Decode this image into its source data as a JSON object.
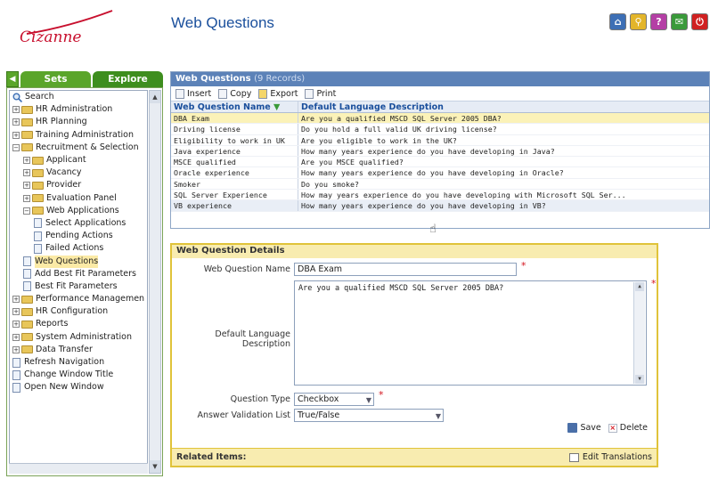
{
  "brand": {
    "logo_text": "Cizanne"
  },
  "page": {
    "title": "Web Questions"
  },
  "top_icons": [
    {
      "name": "home-icon",
      "color": "#3d6fb5",
      "glyph": "⌂"
    },
    {
      "name": "search-icon",
      "color": "#e3b52a",
      "glyph": "⚲"
    },
    {
      "name": "help-icon",
      "color": "#b43fa5",
      "glyph": "?"
    },
    {
      "name": "mail-icon",
      "color": "#3a9a3a",
      "glyph": "✉"
    },
    {
      "name": "power-icon",
      "color": "#d02020",
      "glyph": "⏻"
    }
  ],
  "sidebar": {
    "tabs": {
      "sets": "Sets",
      "explore": "Explore"
    },
    "items": [
      {
        "label": "Search",
        "type": "search",
        "indent": 0
      },
      {
        "label": "HR Administration",
        "type": "folder",
        "indent": 0,
        "exp": "+"
      },
      {
        "label": "HR Planning",
        "type": "folder",
        "indent": 0,
        "exp": "+"
      },
      {
        "label": "Training Administration",
        "type": "folder",
        "indent": 0,
        "exp": "+"
      },
      {
        "label": "Recruitment & Selection",
        "type": "folder",
        "indent": 0,
        "exp": "−"
      },
      {
        "label": "Applicant",
        "type": "folder",
        "indent": 1,
        "exp": "+"
      },
      {
        "label": "Vacancy",
        "type": "folder",
        "indent": 1,
        "exp": "+"
      },
      {
        "label": "Provider",
        "type": "folder",
        "indent": 1,
        "exp": "+"
      },
      {
        "label": "Evaluation Panel",
        "type": "folder",
        "indent": 1,
        "exp": "+"
      },
      {
        "label": "Web Applications",
        "type": "folder",
        "indent": 1,
        "exp": "−"
      },
      {
        "label": "Select Applications",
        "type": "page",
        "indent": 2
      },
      {
        "label": "Pending Actions",
        "type": "page",
        "indent": 2
      },
      {
        "label": "Failed Actions",
        "type": "page",
        "indent": 2
      },
      {
        "label": "Web Questions",
        "type": "page",
        "indent": 1,
        "selected": true
      },
      {
        "label": "Add Best Fit Parameters",
        "type": "page",
        "indent": 1
      },
      {
        "label": "Best Fit Parameters",
        "type": "page",
        "indent": 1
      },
      {
        "label": "Performance Managemen",
        "type": "folder",
        "indent": 0,
        "exp": "+"
      },
      {
        "label": "HR Configuration",
        "type": "folder",
        "indent": 0,
        "exp": "+"
      },
      {
        "label": "Reports",
        "type": "folder",
        "indent": 0,
        "exp": "+"
      },
      {
        "label": "System Administration",
        "type": "folder",
        "indent": 0,
        "exp": "+"
      },
      {
        "label": "Data Transfer",
        "type": "folder",
        "indent": 0,
        "exp": "+"
      },
      {
        "label": "Refresh Navigation",
        "type": "page",
        "indent": 0
      },
      {
        "label": "Change Window Title",
        "type": "page",
        "indent": 0
      },
      {
        "label": "Open New Window",
        "type": "page",
        "indent": 0
      }
    ]
  },
  "grid": {
    "title": "Web Questions",
    "count": "(9 Records)",
    "toolbar": {
      "insert": "Insert",
      "copy": "Copy",
      "export": "Export",
      "print": "Print"
    },
    "columns": {
      "name": "Web Question Name",
      "desc": "Default Language Description"
    },
    "rows": [
      {
        "name": "DBA Exam",
        "desc": "Are you a qualified MSCD SQL Server 2005 DBA?",
        "selected": true
      },
      {
        "name": "Driving license",
        "desc": "Do you hold a full valid UK driving license?"
      },
      {
        "name": "Eligibility to work in UK",
        "desc": "Are you eligible to work in the UK?"
      },
      {
        "name": "Java experience",
        "desc": "How many years experience do you have developing in Java?"
      },
      {
        "name": "MSCE qualified",
        "desc": "Are you MSCE qualified?"
      },
      {
        "name": "Oracle experience",
        "desc": "How many years experience do you have developing in Oracle?"
      },
      {
        "name": "Smoker",
        "desc": "Do you smoke?"
      },
      {
        "name": "SQL Server Experience",
        "desc": "How may years experience do you have developing with Microsoft SQL Ser..."
      },
      {
        "name": "VB experience",
        "desc": "How many years experience do you have developing in VB?"
      }
    ]
  },
  "details": {
    "title": "Web Question Details",
    "name_label": "Web Question Name",
    "name_value": "DBA Exam",
    "desc_label": "Default Language Description",
    "desc_value": "Are you a qualified MSCD SQL Server 2005 DBA?",
    "type_label": "Question Type",
    "type_value": "Checkbox",
    "validation_label": "Answer Validation List",
    "validation_value": "True/False",
    "save": "Save",
    "delete": "Delete",
    "related": "Related Items:",
    "edit_translations": "Edit Translations",
    "required_mark": "*"
  }
}
